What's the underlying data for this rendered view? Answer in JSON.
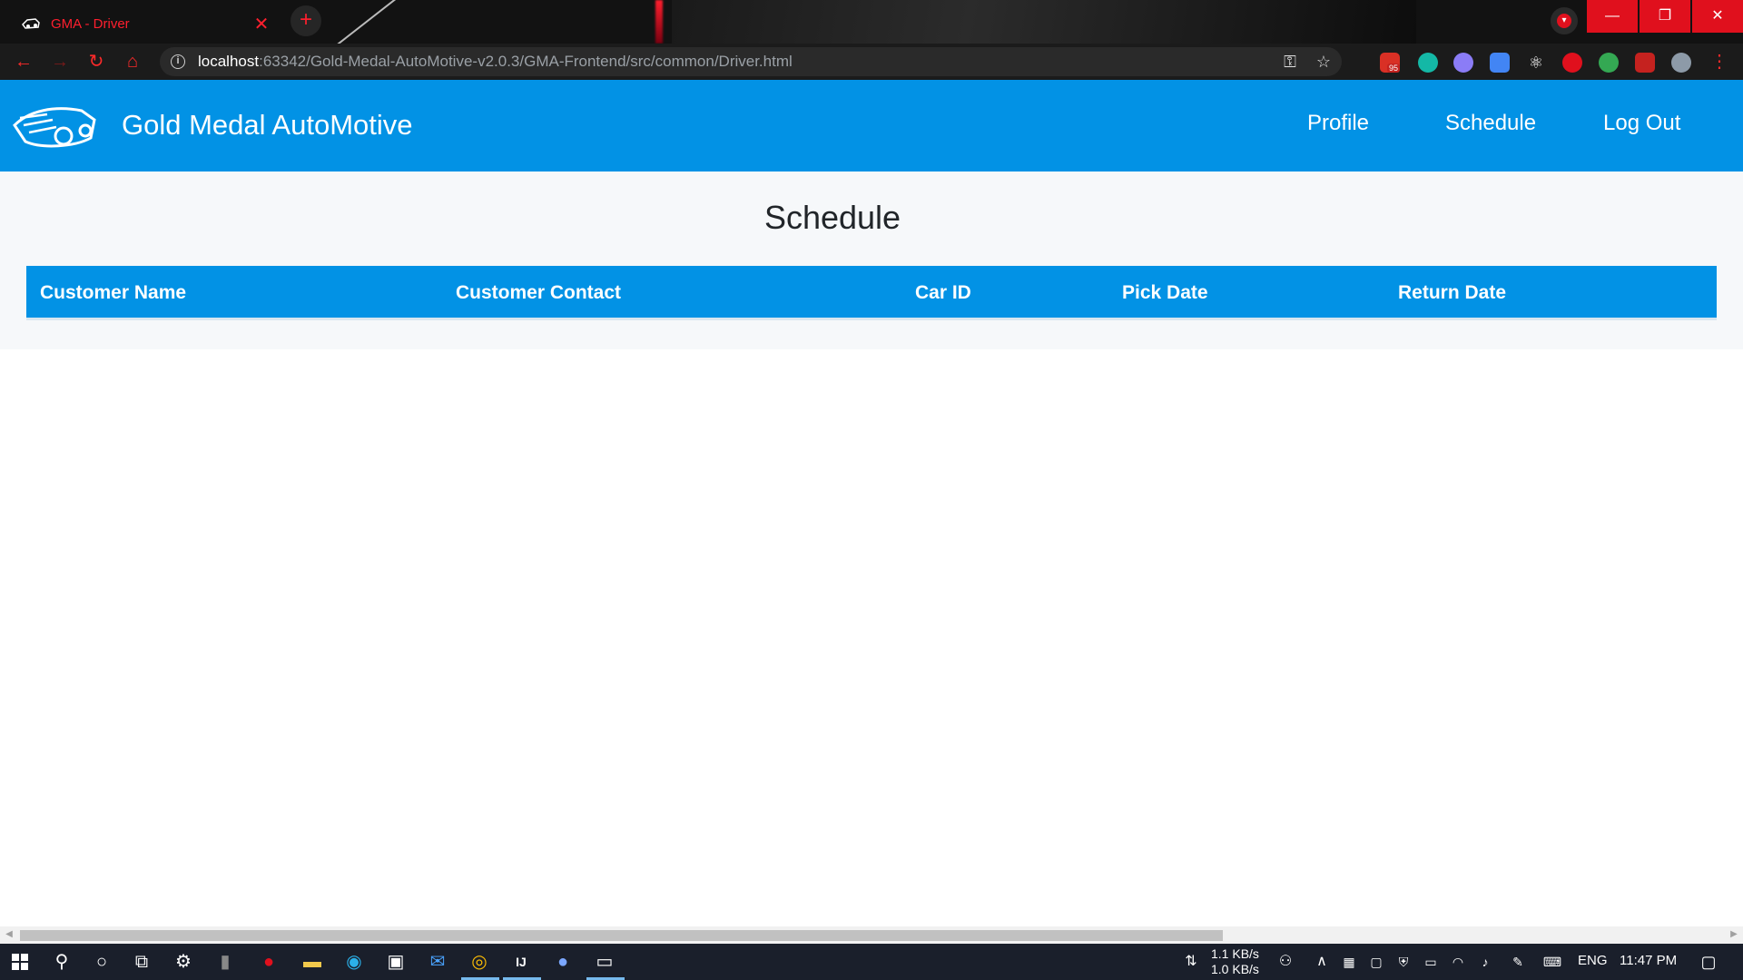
{
  "browser": {
    "tab_title": "GMA - Driver",
    "tab_close": "✕",
    "new_tab": "+",
    "url_host": "localhost",
    "url_rest": ":63342/Gold-Medal-AutoMotive-v2.0.3/GMA-Frontend/src/common/Driver.html",
    "mail_badge": "95",
    "window_minimize": "—",
    "window_restore": "❐",
    "window_close": "✕"
  },
  "navbar": {
    "brand": "Gold Medal AutoMotive",
    "links": [
      "Profile",
      "Schedule",
      "Log Out"
    ]
  },
  "main": {
    "title": "Schedule",
    "table": {
      "columns": [
        "Customer Name",
        "Customer Contact",
        "Car ID",
        "Pick Date",
        "Return Date"
      ],
      "rows": []
    }
  },
  "taskbar": {
    "net_down": "1.1 KB/s",
    "net_up": "1.0 KB/s",
    "language": "ENG",
    "time": "11:47 PM"
  },
  "colors": {
    "primary": "#0292e5",
    "accent_red": "#ff1f2e",
    "content_bg": "#f6f8fa"
  }
}
